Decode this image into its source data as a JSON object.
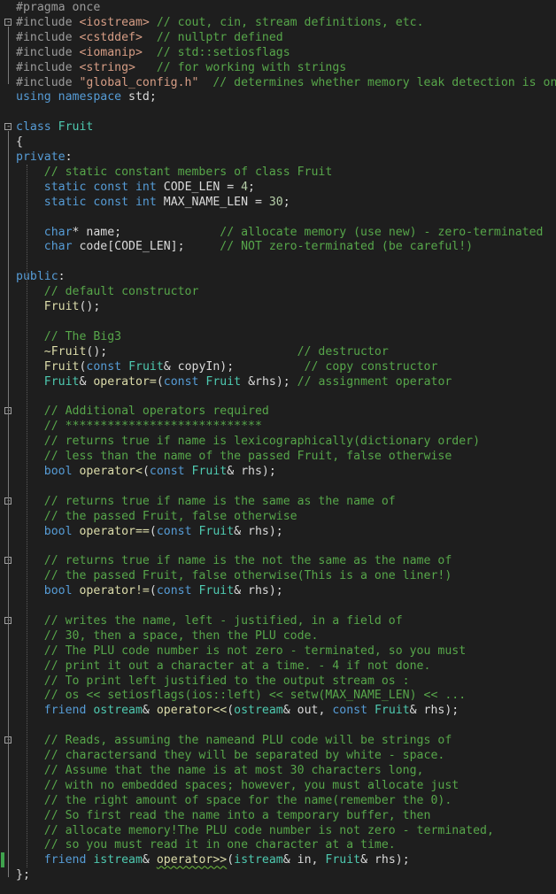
{
  "colors": {
    "background": "#1e1e1e",
    "keyword": "#569cd6",
    "type": "#4ec9b0",
    "preprocessor": "#9b9b9b",
    "string": "#d69d85",
    "comment": "#57a64a",
    "function": "#dcdcaa",
    "number": "#b5cea8",
    "text": "#dcdcdc",
    "change_marker": "#3fa34d"
  },
  "lines": [
    {
      "row": 0,
      "fold": false,
      "tokens": [
        [
          "pp",
          "#pragma once"
        ]
      ]
    },
    {
      "row": 1,
      "fold": true,
      "tokens": [
        [
          "pp",
          "#include "
        ],
        [
          "st",
          "<iostream>"
        ],
        [
          "id",
          " "
        ],
        [
          "cm",
          "// cout, cin, stream definitions, etc."
        ]
      ]
    },
    {
      "row": 2,
      "fold": false,
      "tokens": [
        [
          "pp",
          "#include "
        ],
        [
          "st",
          "<cstddef>"
        ],
        [
          "id",
          "  "
        ],
        [
          "cm",
          "// nullptr defined"
        ]
      ]
    },
    {
      "row": 3,
      "fold": false,
      "tokens": [
        [
          "pp",
          "#include "
        ],
        [
          "st",
          "<iomanip>"
        ],
        [
          "id",
          "  "
        ],
        [
          "cm",
          "// std::setiosflags"
        ]
      ]
    },
    {
      "row": 4,
      "fold": false,
      "tokens": [
        [
          "pp",
          "#include "
        ],
        [
          "st",
          "<string>"
        ],
        [
          "id",
          "   "
        ],
        [
          "cm",
          "// for working with strings"
        ]
      ]
    },
    {
      "row": 5,
      "fold": false,
      "tokens": [
        [
          "pp",
          "#include "
        ],
        [
          "st",
          "\"global_config.h\""
        ],
        [
          "id",
          "  "
        ],
        [
          "cm",
          "// determines whether memory leak detection is on"
        ]
      ]
    },
    {
      "row": 6,
      "fold": false,
      "tokens": [
        [
          "kw",
          "using namespace "
        ],
        [
          "id",
          "std;"
        ]
      ]
    },
    {
      "row": 7,
      "fold": false,
      "tokens": []
    },
    {
      "row": 8,
      "fold": true,
      "tokens": [
        [
          "kw",
          "class "
        ],
        [
          "ty",
          "Fruit"
        ]
      ]
    },
    {
      "row": 9,
      "fold": false,
      "tokens": [
        [
          "id",
          "{"
        ]
      ]
    },
    {
      "row": 10,
      "fold": false,
      "tokens": [
        [
          "kw",
          "private"
        ],
        [
          "id",
          ":"
        ]
      ]
    },
    {
      "row": 11,
      "fold": false,
      "tokens": [
        [
          "id",
          "    "
        ],
        [
          "cm",
          "// static constant members of class Fruit"
        ]
      ]
    },
    {
      "row": 12,
      "fold": false,
      "tokens": [
        [
          "id",
          "    "
        ],
        [
          "kw",
          "static const int "
        ],
        [
          "id",
          "CODE_LEN = "
        ],
        [
          "nm",
          "4"
        ],
        [
          "id",
          ";"
        ]
      ]
    },
    {
      "row": 13,
      "fold": false,
      "tokens": [
        [
          "id",
          "    "
        ],
        [
          "kw",
          "static const int "
        ],
        [
          "id",
          "MAX_NAME_LEN = "
        ],
        [
          "nm",
          "30"
        ],
        [
          "id",
          ";"
        ]
      ]
    },
    {
      "row": 14,
      "fold": false,
      "tokens": []
    },
    {
      "row": 15,
      "fold": false,
      "tokens": [
        [
          "id",
          "    "
        ],
        [
          "kw",
          "char"
        ],
        [
          "id",
          "* name;              "
        ],
        [
          "cm",
          "// allocate memory (use new) - zero-terminated"
        ]
      ]
    },
    {
      "row": 16,
      "fold": false,
      "tokens": [
        [
          "id",
          "    "
        ],
        [
          "kw",
          "char "
        ],
        [
          "id",
          "code[CODE_LEN];     "
        ],
        [
          "cm",
          "// NOT zero-terminated (be careful!)"
        ]
      ]
    },
    {
      "row": 17,
      "fold": false,
      "tokens": []
    },
    {
      "row": 18,
      "fold": false,
      "tokens": [
        [
          "kw",
          "public"
        ],
        [
          "id",
          ":"
        ]
      ]
    },
    {
      "row": 19,
      "fold": false,
      "tokens": [
        [
          "id",
          "    "
        ],
        [
          "cm",
          "// default constructor"
        ]
      ]
    },
    {
      "row": 20,
      "fold": false,
      "tokens": [
        [
          "id",
          "    "
        ],
        [
          "fn",
          "Fruit"
        ],
        [
          "id",
          "();"
        ]
      ]
    },
    {
      "row": 21,
      "fold": false,
      "tokens": []
    },
    {
      "row": 22,
      "fold": false,
      "tokens": [
        [
          "id",
          "    "
        ],
        [
          "cm",
          "// The Big3"
        ]
      ]
    },
    {
      "row": 23,
      "fold": false,
      "tokens": [
        [
          "id",
          "    "
        ],
        [
          "fn",
          "~Fruit"
        ],
        [
          "id",
          "();                           "
        ],
        [
          "cm",
          "// destructor"
        ]
      ]
    },
    {
      "row": 24,
      "fold": false,
      "tokens": [
        [
          "id",
          "    "
        ],
        [
          "fn",
          "Fruit"
        ],
        [
          "id",
          "("
        ],
        [
          "kw",
          "const "
        ],
        [
          "ty",
          "Fruit"
        ],
        [
          "id",
          "& copyIn);          "
        ],
        [
          "cm",
          "// copy constructor"
        ]
      ]
    },
    {
      "row": 25,
      "fold": false,
      "tokens": [
        [
          "id",
          "    "
        ],
        [
          "ty",
          "Fruit"
        ],
        [
          "id",
          "& "
        ],
        [
          "fn",
          "operator="
        ],
        [
          "id",
          "("
        ],
        [
          "kw",
          "const "
        ],
        [
          "ty",
          "Fruit"
        ],
        [
          "id",
          " &rhs); "
        ],
        [
          "cm",
          "// assignment operator"
        ]
      ]
    },
    {
      "row": 26,
      "fold": false,
      "tokens": []
    },
    {
      "row": 27,
      "fold": true,
      "tokens": [
        [
          "id",
          "    "
        ],
        [
          "cm",
          "// Additional operators required"
        ]
      ]
    },
    {
      "row": 28,
      "fold": false,
      "tokens": [
        [
          "id",
          "    "
        ],
        [
          "cm",
          "// ****************************"
        ]
      ]
    },
    {
      "row": 29,
      "fold": false,
      "tokens": [
        [
          "id",
          "    "
        ],
        [
          "cm",
          "// returns true if name is lexicographically(dictionary order)"
        ]
      ]
    },
    {
      "row": 30,
      "fold": false,
      "tokens": [
        [
          "id",
          "    "
        ],
        [
          "cm",
          "// less than the name of the passed Fruit, false otherwise"
        ]
      ]
    },
    {
      "row": 31,
      "fold": false,
      "tokens": [
        [
          "id",
          "    "
        ],
        [
          "kw",
          "bool "
        ],
        [
          "fn",
          "operator<"
        ],
        [
          "id",
          "("
        ],
        [
          "kw",
          "const "
        ],
        [
          "ty",
          "Fruit"
        ],
        [
          "id",
          "& rhs);"
        ]
      ]
    },
    {
      "row": 32,
      "fold": false,
      "tokens": []
    },
    {
      "row": 33,
      "fold": true,
      "tokens": [
        [
          "id",
          "    "
        ],
        [
          "cm",
          "// returns true if name is the same as the name of"
        ]
      ]
    },
    {
      "row": 34,
      "fold": false,
      "tokens": [
        [
          "id",
          "    "
        ],
        [
          "cm",
          "// the passed Fruit, false otherwise"
        ]
      ]
    },
    {
      "row": 35,
      "fold": false,
      "tokens": [
        [
          "id",
          "    "
        ],
        [
          "kw",
          "bool "
        ],
        [
          "fn",
          "operator=="
        ],
        [
          "id",
          "("
        ],
        [
          "kw",
          "const "
        ],
        [
          "ty",
          "Fruit"
        ],
        [
          "id",
          "& rhs);"
        ]
      ]
    },
    {
      "row": 36,
      "fold": false,
      "tokens": []
    },
    {
      "row": 37,
      "fold": true,
      "tokens": [
        [
          "id",
          "    "
        ],
        [
          "cm",
          "// returns true if name is the not the same as the name of"
        ]
      ]
    },
    {
      "row": 38,
      "fold": false,
      "tokens": [
        [
          "id",
          "    "
        ],
        [
          "cm",
          "// the passed Fruit, false otherwise(This is a one liner!)"
        ]
      ]
    },
    {
      "row": 39,
      "fold": false,
      "tokens": [
        [
          "id",
          "    "
        ],
        [
          "kw",
          "bool "
        ],
        [
          "fn",
          "operator!="
        ],
        [
          "id",
          "("
        ],
        [
          "kw",
          "const "
        ],
        [
          "ty",
          "Fruit"
        ],
        [
          "id",
          "& rhs);"
        ]
      ]
    },
    {
      "row": 40,
      "fold": false,
      "tokens": []
    },
    {
      "row": 41,
      "fold": true,
      "tokens": [
        [
          "id",
          "    "
        ],
        [
          "cm",
          "// writes the name, left - justified, in a field of"
        ]
      ]
    },
    {
      "row": 42,
      "fold": false,
      "tokens": [
        [
          "id",
          "    "
        ],
        [
          "cm",
          "// 30, then a space, then the PLU code."
        ]
      ]
    },
    {
      "row": 43,
      "fold": false,
      "tokens": [
        [
          "id",
          "    "
        ],
        [
          "cm",
          "// The PLU code number is not zero - terminated, so you must"
        ]
      ]
    },
    {
      "row": 44,
      "fold": false,
      "tokens": [
        [
          "id",
          "    "
        ],
        [
          "cm",
          "// print it out a character at a time. - 4 if not done."
        ]
      ]
    },
    {
      "row": 45,
      "fold": false,
      "tokens": [
        [
          "id",
          "    "
        ],
        [
          "cm",
          "// To print left justified to the output stream os :"
        ]
      ]
    },
    {
      "row": 46,
      "fold": false,
      "tokens": [
        [
          "id",
          "    "
        ],
        [
          "cm",
          "// os << setiosflags(ios::left) << setw(MAX_NAME_LEN) << ..."
        ]
      ]
    },
    {
      "row": 47,
      "fold": false,
      "tokens": [
        [
          "id",
          "    "
        ],
        [
          "kw",
          "friend "
        ],
        [
          "ty",
          "ostream"
        ],
        [
          "id",
          "& "
        ],
        [
          "fn",
          "operator<<"
        ],
        [
          "id",
          "("
        ],
        [
          "ty",
          "ostream"
        ],
        [
          "id",
          "& out, "
        ],
        [
          "kw",
          "const "
        ],
        [
          "ty",
          "Fruit"
        ],
        [
          "id",
          "& rhs);"
        ]
      ]
    },
    {
      "row": 48,
      "fold": false,
      "tokens": []
    },
    {
      "row": 49,
      "fold": true,
      "tokens": [
        [
          "id",
          "    "
        ],
        [
          "cm",
          "// Reads, assuming the nameand PLU code will be strings of"
        ]
      ]
    },
    {
      "row": 50,
      "fold": false,
      "tokens": [
        [
          "id",
          "    "
        ],
        [
          "cm",
          "// charactersand they will be separated by white - space."
        ]
      ]
    },
    {
      "row": 51,
      "fold": false,
      "tokens": [
        [
          "id",
          "    "
        ],
        [
          "cm",
          "// Assume that the name is at most 30 characters long,"
        ]
      ]
    },
    {
      "row": 52,
      "fold": false,
      "tokens": [
        [
          "id",
          "    "
        ],
        [
          "cm",
          "// with no embedded spaces; however, you must allocate just"
        ]
      ]
    },
    {
      "row": 53,
      "fold": false,
      "tokens": [
        [
          "id",
          "    "
        ],
        [
          "cm",
          "// the right amount of space for the name(remember the 0)."
        ]
      ]
    },
    {
      "row": 54,
      "fold": false,
      "tokens": [
        [
          "id",
          "    "
        ],
        [
          "cm",
          "// So first read the name into a temporary buffer, then"
        ]
      ]
    },
    {
      "row": 55,
      "fold": false,
      "tokens": [
        [
          "id",
          "    "
        ],
        [
          "cm",
          "// allocate memory!The PLU code number is not zero - terminated,"
        ]
      ]
    },
    {
      "row": 56,
      "fold": false,
      "tokens": [
        [
          "id",
          "    "
        ],
        [
          "cm",
          "// so you must read it in one character at a time."
        ]
      ]
    },
    {
      "row": 57,
      "fold": false,
      "tokens": [
        [
          "id",
          "    "
        ],
        [
          "kw",
          "friend "
        ],
        [
          "ty",
          "istream"
        ],
        [
          "id",
          "& "
        ],
        [
          "fn",
          "operator>>"
        ],
        [
          "id",
          "("
        ],
        [
          "ty",
          "istream"
        ],
        [
          "id",
          "& in, "
        ],
        [
          "ty",
          "Fruit"
        ],
        [
          "id",
          "& rhs);"
        ]
      ]
    },
    {
      "row": 58,
      "fold": false,
      "tokens": [
        [
          "id",
          "};"
        ]
      ]
    }
  ]
}
